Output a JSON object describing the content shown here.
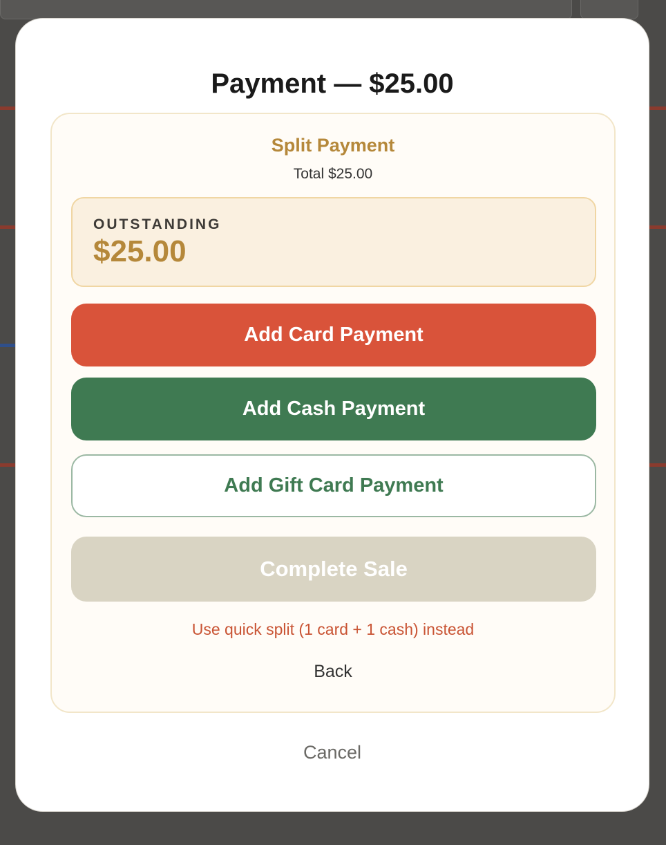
{
  "modal": {
    "title": "Payment — $25.00",
    "cancel_label": "Cancel"
  },
  "split": {
    "title": "Split Payment",
    "total_text": "Total $25.00",
    "outstanding_label": "OUTSTANDING",
    "outstanding_amount": "$25.00",
    "add_card_label": "Add Card Payment",
    "add_cash_label": "Add Cash Payment",
    "add_gift_card_label": "Add Gift Card Payment",
    "complete_sale_label": "Complete Sale",
    "quick_split_label": "Use quick split (1 card + 1 cash) instead",
    "back_label": "Back"
  },
  "colors": {
    "accent_gold": "#b5883a",
    "card_button": "#d9533a",
    "cash_button": "#3f7a52",
    "complete_disabled": "#d9d4c3",
    "overlay": "#4b4a48"
  }
}
